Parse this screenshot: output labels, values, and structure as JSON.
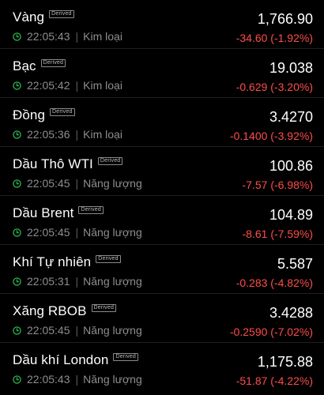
{
  "colors": {
    "background": "#000000",
    "clock_green": "#34c759",
    "negative_red": "#ff4c4c",
    "meta_gray": "#8e8e93"
  },
  "icons": {
    "status": "clock-icon"
  },
  "badge_label": "Derived",
  "rows": [
    {
      "name": "Vàng",
      "time": "22:05:43",
      "category": "Kim loại",
      "price": "1,766.90",
      "change": "-34.60 (-1.92%)"
    },
    {
      "name": "Bạc",
      "time": "22:05:42",
      "category": "Kim loại",
      "price": "19.038",
      "change": "-0.629 (-3.20%)"
    },
    {
      "name": "Đồng",
      "time": "22:05:36",
      "category": "Kim loại",
      "price": "3.4270",
      "change": "-0.1400 (-3.92%)"
    },
    {
      "name": "Dầu Thô WTI",
      "time": "22:05:45",
      "category": "Năng lượng",
      "price": "100.86",
      "change": "-7.57 (-6.98%)"
    },
    {
      "name": "Dầu Brent",
      "time": "22:05:45",
      "category": "Năng lượng",
      "price": "104.89",
      "change": "-8.61 (-7.59%)"
    },
    {
      "name": "Khí Tự nhiên",
      "time": "22:05:31",
      "category": "Năng lượng",
      "price": "5.587",
      "change": "-0.283 (-4.82%)"
    },
    {
      "name": "Xăng RBOB",
      "time": "22:05:45",
      "category": "Năng lượng",
      "price": "3.4288",
      "change": "-0.2590 (-7.02%)"
    },
    {
      "name": "Dầu khí London",
      "time": "22:05:43",
      "category": "Năng lượng",
      "price": "1,175.88",
      "change": "-51.87 (-4.22%)"
    }
  ]
}
